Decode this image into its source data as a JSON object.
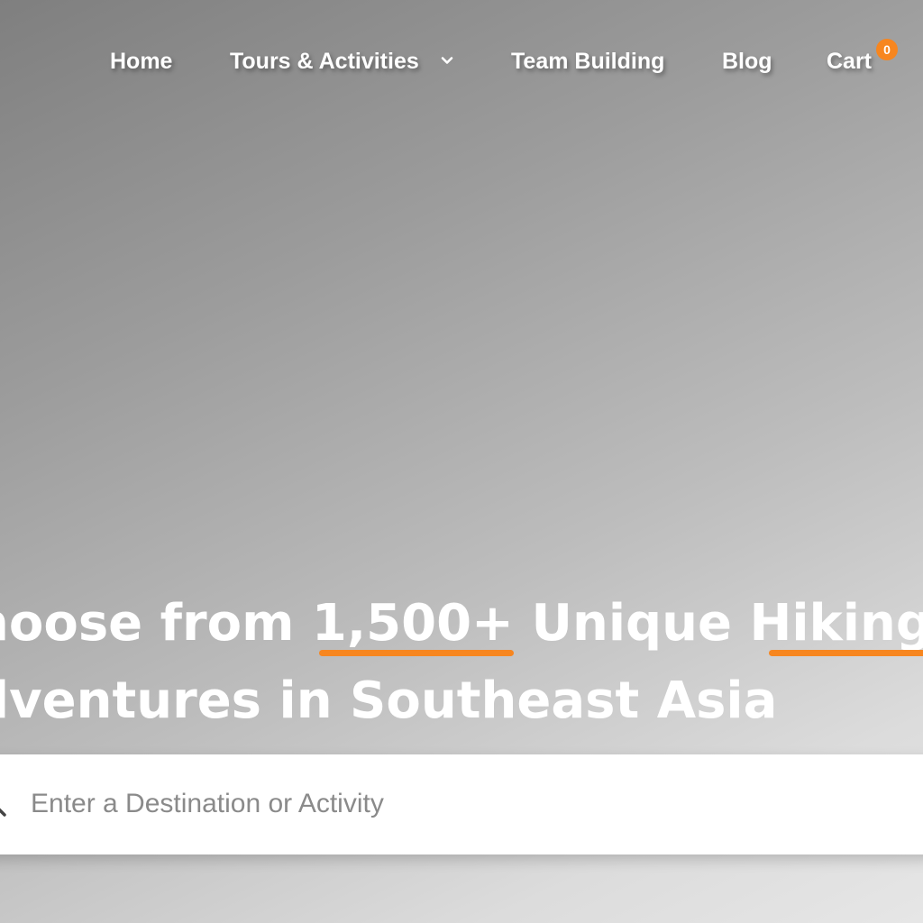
{
  "nav": {
    "items": [
      {
        "label": "Home"
      },
      {
        "label": "Tours & Activities"
      },
      {
        "label": "Team Building"
      },
      {
        "label": "Blog"
      },
      {
        "label": "Cart"
      }
    ],
    "cart_count": "0",
    "dropdown_icon": "chevron-down-icon"
  },
  "hero": {
    "line1_prefix": "hoose from ",
    "line1_number": "1,500+",
    "line1_middle": " Unique ",
    "line1_word": "Hiking",
    "line2": "dventures in Southeast Asia"
  },
  "search": {
    "placeholder": "Enter a Destination or Activity",
    "value": "",
    "icon": "search-icon"
  },
  "colors": {
    "accent": "#f7861f",
    "text": "#ffffff",
    "placeholder": "#8a8a8a"
  }
}
